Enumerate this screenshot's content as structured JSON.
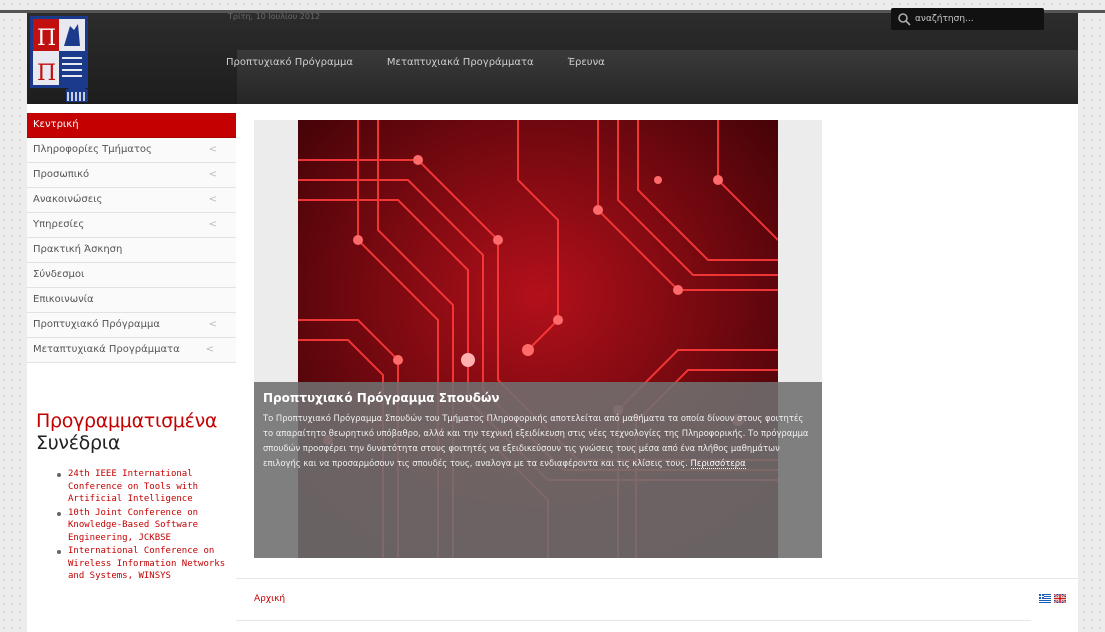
{
  "header": {
    "date": "Τρίτη, 10 Ιουλίου 2012",
    "search_placeholder": "αναζήτηση...",
    "nav": [
      {
        "label": "Προπτυχιακό Πρόγραμμα"
      },
      {
        "label": "Μεταπτυχιακά Προγράμματα"
      },
      {
        "label": "Έρευνα"
      }
    ]
  },
  "sidebar": {
    "menu": [
      {
        "label": "Κεντρική",
        "active": true,
        "submenu": false
      },
      {
        "label": "Πληροφορίες Τμήματος",
        "submenu": true
      },
      {
        "label": "Προσωπικό",
        "submenu": true
      },
      {
        "label": "Ανακοινώσεις",
        "submenu": true
      },
      {
        "label": "Υπηρεσίες",
        "submenu": true
      },
      {
        "label": "Πρακτική Άσκηση",
        "submenu": false
      },
      {
        "label": "Σύνδεσμοι",
        "submenu": false
      },
      {
        "label": "Επικοινωνία",
        "submenu": false
      },
      {
        "label": "Προπτυχιακό Πρόγραμμα",
        "submenu": true
      },
      {
        "label": "Μεταπτυχιακά Προγράμματα",
        "submenu": true
      }
    ],
    "conferences": {
      "title_red": "Προγραμματισμένα",
      "title_dark": "Συνέδρια",
      "items": [
        "24th IEEE International Conference on Tools with Artificial Intelligence",
        "10th Joint Conference on Knowledge-Based Software Engineering, JCKBSE",
        "International Conference on Wireless Information Networks and Systems, WINSYS"
      ]
    }
  },
  "slider": {
    "title": "Προπτυχιακό Πρόγραμμα Σπουδών",
    "text": "Το Προπτυχιακό Πρόγραμμα Σπουδών του Τμήματος Πληροφορικής αποτελείται από μαθήματα τα οποία δίνουν στους φοιτητές το απαραίτητο θεωρητικό υπόβαθρο, αλλά και την τεχνική εξειδίκευση στις νέες τεχνολογίες της Πληροφορικής. Το πρόγραμμα σπουδών προσφέρει την δυνατότητα στους φοιτητές να εξειδικεύσουν τις γνώσεις τους μέσα από ένα πλήθος μαθημάτων επιλογής και να προσαρμόσουν τις σπουδές τους, αναλογα με τα ενδιαφέροντα και τις κλίσεις τους.",
    "more": "Περισσότερα"
  },
  "footer": {
    "home": "Αρχική"
  },
  "colors": {
    "accent": "#c40000",
    "header_bg": "#262626"
  }
}
